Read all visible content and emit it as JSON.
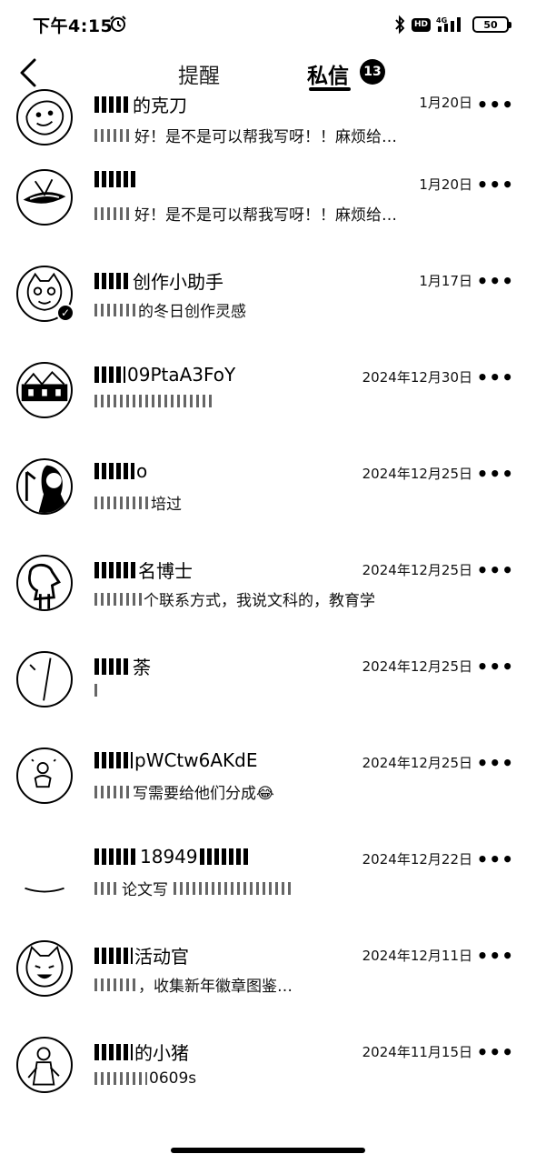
{
  "status_bar": {
    "time": "下午4:15",
    "network": "4G",
    "hd_label": "HD",
    "battery": "50"
  },
  "header": {
    "tabs": [
      {
        "label": "提醒"
      },
      {
        "label": "私信",
        "badge": "13"
      }
    ]
  },
  "conversations": [
    {
      "name": "的克刀",
      "preview": "好！是不是可以帮我写呀！！麻烦给…",
      "date": "1月20日",
      "avatar": "sketch-face"
    },
    {
      "name": "",
      "preview": "好！是不是可以帮我写呀！！麻烦给…",
      "date": "1月20日",
      "avatar": "lips"
    },
    {
      "name": "创作小助手",
      "preview": "的冬日创作灵感",
      "date": "1月17日",
      "avatar": "cat-verified",
      "verified": true
    },
    {
      "name": "09PtaA3FoY",
      "preview": "",
      "date": "2024年12月30日",
      "avatar": "scene"
    },
    {
      "name": "o",
      "preview": "培过",
      "date": "2024年12月25日",
      "avatar": "girl"
    },
    {
      "name": "名博士",
      "preview": "个联系方式，我说文科的，教育学",
      "date": "2024年12月25日",
      "avatar": "person"
    },
    {
      "name": "荼",
      "preview": "",
      "date": "2024年12月25日",
      "avatar": "line"
    },
    {
      "name": "pWCtw6AKdE",
      "preview": "写需要给他们分成😂",
      "date": "2024年12月25日",
      "avatar": "small-figure"
    },
    {
      "name": "18949",
      "preview": "论文写",
      "date": "2024年12月22日",
      "avatar": "blank"
    },
    {
      "name": "活动官",
      "preview": "，收集新年徽章图鉴…",
      "date": "2024年12月11日",
      "avatar": "cat"
    },
    {
      "name": "的小猪",
      "preview": "0609s",
      "date": "2024年11月15日",
      "avatar": "figure"
    }
  ],
  "icons": {
    "back": "chevron-left-icon",
    "more": "more-horizontal-icon",
    "alarm": "alarm-clock-icon",
    "bluetooth": "bluetooth-icon",
    "signal": "signal-icon"
  }
}
